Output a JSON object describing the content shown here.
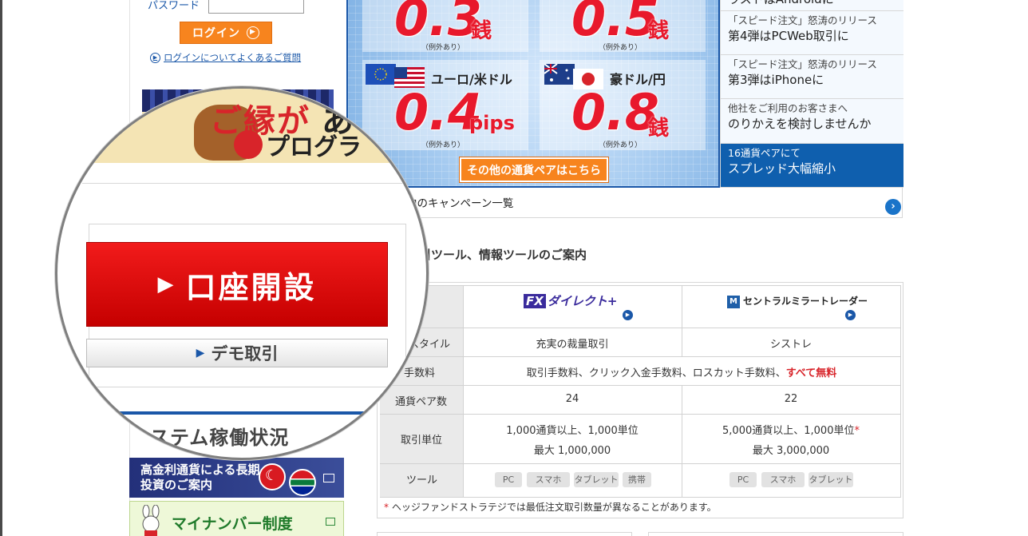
{
  "login": {
    "password_label": "パスワード",
    "login_button": "ログイン",
    "faq_link": "ログインについてよくあるご質問"
  },
  "magnifier": {
    "banner_kanji": "ご縁が",
    "banner_kanji2": "あ",
    "banner_sub": "プログラ",
    "open_account": "口座開設",
    "demo_trade": "デモ取引",
    "system_status": "システム稼働状況"
  },
  "side_banners": {
    "high_interest": "高金利通貨による長期投資のご案内",
    "my_number": "マイナンバー制度"
  },
  "rates": [
    {
      "pair": "",
      "value": "0.3",
      "unit": "銭",
      "note": "（例外あり）"
    },
    {
      "pair": "",
      "value": "0.5",
      "unit": "銭",
      "note": "（例外あり）"
    },
    {
      "pair": "ユーロ/米ドル",
      "value": "0.4",
      "unit": "pips",
      "note": "（例外あり）"
    },
    {
      "pair": "豪ドル/円",
      "value": "0.8",
      "unit": "銭",
      "note": "（例外あり）"
    }
  ],
  "more_pairs_button": "その他の通貨ペアはこちら",
  "news": [
    {
      "small": "",
      "big": "ラストはAndroidに"
    },
    {
      "small": "「スピード注文」怒涛のリリース",
      "big": "第4弾はPCWeb取引に"
    },
    {
      "small": "「スピード注文」怒涛のリリース",
      "big": "第3弾はiPhoneに"
    },
    {
      "small": "他社をご利用のお客さまへ",
      "big": "のりかえを検討しませんか"
    },
    {
      "small": "16通貨ペアにて",
      "big": "スプレッド大幅縮小"
    }
  ],
  "campaign_text": "中のキャンペーン一覧",
  "section_title": "取引ツール、情報ツールのご案内",
  "table": {
    "products": [
      "ダイレクト",
      "セントラルミラートレーダー"
    ],
    "fx_box": "FX",
    "cm_box": "M",
    "rows": [
      {
        "label": "スタイル",
        "c1": "充実の裁量取引",
        "c2": "シストレ"
      },
      {
        "label": "手数料",
        "merged": "取引手数料、クリック入金手数料、ロスカット手数料、",
        "merged_red": "すべて無料"
      },
      {
        "label": "通貨ペア数",
        "c1": "24",
        "c2": "22"
      },
      {
        "label": "取引単位",
        "c1a": "1,000通貨以上、1,000単位",
        "c1b": "最大 1,000,000",
        "c2a": "5,000通貨以上、1,000単位",
        "c2b": "最大 3,000,000"
      },
      {
        "label": "ツール"
      }
    ],
    "tools_fx": [
      "PC",
      "スマホ",
      "タブレット",
      "携帯"
    ],
    "tools_cm": [
      "PC",
      "スマホ",
      "タブレット"
    ],
    "note": "ヘッジファンドストラテジでは最低注文取引数量が異なることがあります。"
  },
  "colors": {
    "accent_orange": "#f7841e",
    "brand_blue": "#1a57a8",
    "rate_red": "#e8192c"
  }
}
